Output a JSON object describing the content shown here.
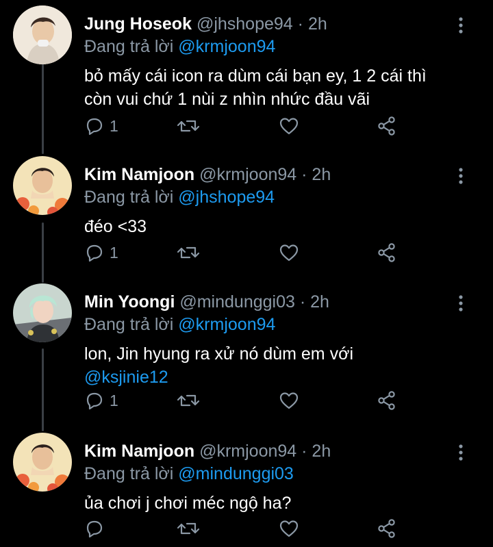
{
  "theme": {
    "background": "#000000",
    "text": "#ffffff",
    "muted": "#8b98a5",
    "accent": "#1d9bf0",
    "thread_line": "#3a3f45"
  },
  "reply_prefix": "Đang trả lời",
  "tweets": [
    {
      "name": "Jung Hoseok",
      "handle": "@jhshope94",
      "separator": "·",
      "time": "2h",
      "replying_to": "@krmjoon94",
      "text_lines": [
        "bỏ mấy cái icon ra dùm cái bạn ey, 1 2 cái thì",
        "còn vui chứ 1 nùi z nhìn nhức đầu vãi"
      ],
      "reply_count": "1",
      "avatar_icon": "avatar-photo"
    },
    {
      "name": "Kim Namjoon",
      "handle": "@krmjoon94",
      "separator": "·",
      "time": "2h",
      "replying_to": "@jhshope94",
      "text_lines": [
        "đéo <33"
      ],
      "reply_count": "1",
      "avatar_icon": "avatar-photo"
    },
    {
      "name": "Min Yoongi",
      "handle": "@mindunggi03",
      "separator": "·",
      "time": "2h",
      "replying_to": "@krmjoon94",
      "text_lines": [
        "lon, Jin hyung ra xử nó dùm em với"
      ],
      "mention_line": "@ksjinie12",
      "reply_count": "1",
      "avatar_icon": "avatar-photo"
    },
    {
      "name": "Kim Namjoon",
      "handle": "@krmjoon94",
      "separator": "·",
      "time": "2h",
      "replying_to": "@mindunggi03",
      "text_lines": [
        "ủa chơi j chơi méc ngộ ha?"
      ],
      "reply_count": "",
      "avatar_icon": "avatar-photo"
    }
  ],
  "icons": {
    "reply": "reply-icon",
    "retweet": "retweet-icon",
    "like": "heart-icon",
    "share": "share-icon",
    "more": "more-vertical-icon"
  }
}
